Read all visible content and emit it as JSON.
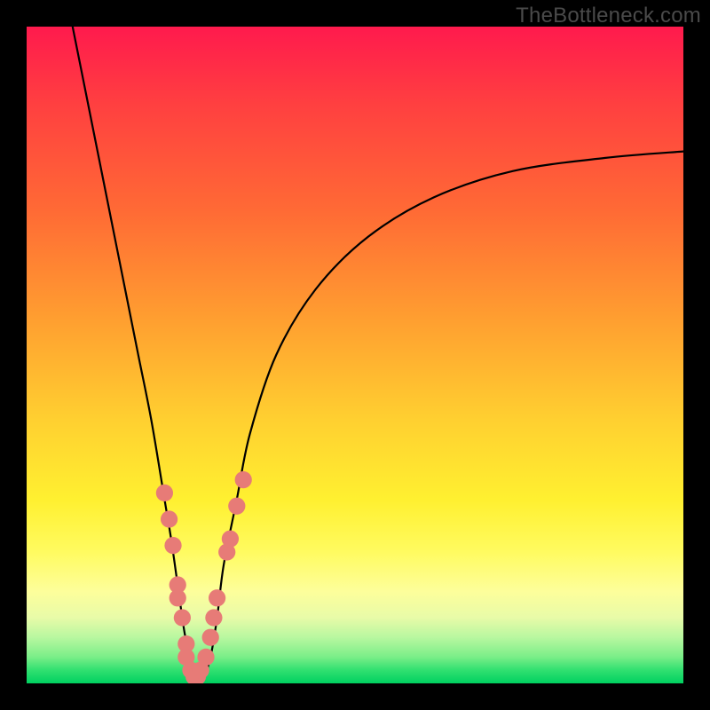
{
  "watermark": "TheBottleneck.com",
  "chart_data": {
    "type": "line",
    "title": "",
    "xlabel": "",
    "ylabel": "",
    "xlim": [
      0,
      100
    ],
    "ylim": [
      0,
      100
    ],
    "background_gradient": {
      "top": "#ff1a4d",
      "mid": "#fff030",
      "bottom": "#00d060"
    },
    "series": [
      {
        "name": "v-curve",
        "color": "#000000",
        "x": [
          7,
          9,
          11,
          13,
          15,
          17,
          19,
          21,
          22,
          23,
          24,
          25,
          25.5,
          26,
          27,
          28,
          29,
          30,
          32,
          34,
          38,
          44,
          52,
          62,
          74,
          88,
          100
        ],
        "values": [
          100,
          90,
          80,
          70,
          60,
          50,
          40,
          28,
          22,
          15,
          8,
          3,
          1,
          0,
          1,
          4,
          10,
          18,
          28,
          38,
          50,
          60,
          68,
          74,
          78,
          80,
          81
        ]
      }
    ],
    "markers": {
      "name": "marker-dots",
      "color": "#e77b77",
      "radius": 1.3,
      "points": [
        {
          "x": 21.0,
          "y": 29
        },
        {
          "x": 21.7,
          "y": 25
        },
        {
          "x": 22.3,
          "y": 21
        },
        {
          "x": 23.0,
          "y": 15
        },
        {
          "x": 23.0,
          "y": 13
        },
        {
          "x": 23.7,
          "y": 10
        },
        {
          "x": 24.3,
          "y": 6
        },
        {
          "x": 24.3,
          "y": 4
        },
        {
          "x": 25.0,
          "y": 2
        },
        {
          "x": 25.5,
          "y": 1
        },
        {
          "x": 26.0,
          "y": 1
        },
        {
          "x": 26.5,
          "y": 2
        },
        {
          "x": 27.3,
          "y": 4
        },
        {
          "x": 28.0,
          "y": 7
        },
        {
          "x": 28.5,
          "y": 10
        },
        {
          "x": 29.0,
          "y": 13
        },
        {
          "x": 30.5,
          "y": 20
        },
        {
          "x": 31.0,
          "y": 22
        },
        {
          "x": 32.0,
          "y": 27
        },
        {
          "x": 33.0,
          "y": 31
        }
      ]
    }
  }
}
